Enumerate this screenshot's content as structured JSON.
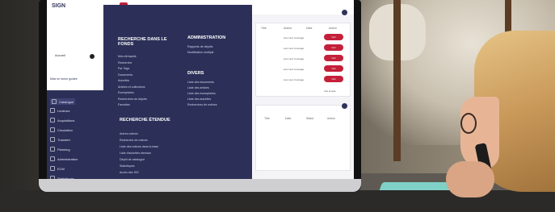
{
  "app": {
    "logo": "SIGN",
    "logo_sub": "",
    "user_name": "Accueil",
    "side_link": "Mise en forme guidée"
  },
  "nav": [
    {
      "label": "Catalogue",
      "active": true
    },
    {
      "label": "Lecteurs",
      "active": false
    },
    {
      "label": "Acquisitions",
      "active": false
    },
    {
      "label": "Circulation",
      "active": false
    },
    {
      "label": "Transfert",
      "active": false
    },
    {
      "label": "Planning",
      "active": false
    },
    {
      "label": "Administration",
      "active": false
    },
    {
      "label": "ECM",
      "active": false
    },
    {
      "label": "Statistiques",
      "active": false
    }
  ],
  "menu": {
    "col1_title": "RECHERCHE DANS LE FONDS",
    "col1_items": [
      "Mot-clé/rapide",
      "Recherche",
      "Par Tags",
      "Documents",
      "Autorités",
      "Articles et collections",
      "Exemplaires",
      "Recherches de dépôts",
      "Favorites"
    ],
    "col2_title": "ADMINISTRATION",
    "col2_items": [
      "Rapports de dépôts",
      "Modification multiple"
    ],
    "col3_title": "DIVERS",
    "col3_items": [
      "Liste des documents",
      "Liste des articles",
      "Liste des exemplaires",
      "Liste des autorités",
      "Recherches de notices"
    ],
    "col4_title": "RECHERCHE ÉTENDUE",
    "col4_items": [
      "Autres notices",
      "Recherche de notices",
      "Liste des notices dans la base",
      "Liste d'autorités étendue",
      "Dépôt de catalogue",
      "Statistiques",
      "Accès des SIG"
    ]
  },
  "content": {
    "card1_cols": [
      "Titre",
      "Auteur",
      "Date",
      "Action"
    ],
    "card1_rows": [
      "Lien vers l'ouvrage",
      "Lien vers l'ouvrage",
      "Lien vers l'ouvrage",
      "Lien vers l'ouvrage",
      "Lien vers l'ouvrage"
    ],
    "btn_label": "Voir",
    "card1_link": "Voir la liste",
    "card2_cols": [
      "Titre",
      "Date",
      "Statut",
      "Action"
    ]
  },
  "colors": {
    "navy": "#2c3058",
    "red": "#c4203a"
  }
}
